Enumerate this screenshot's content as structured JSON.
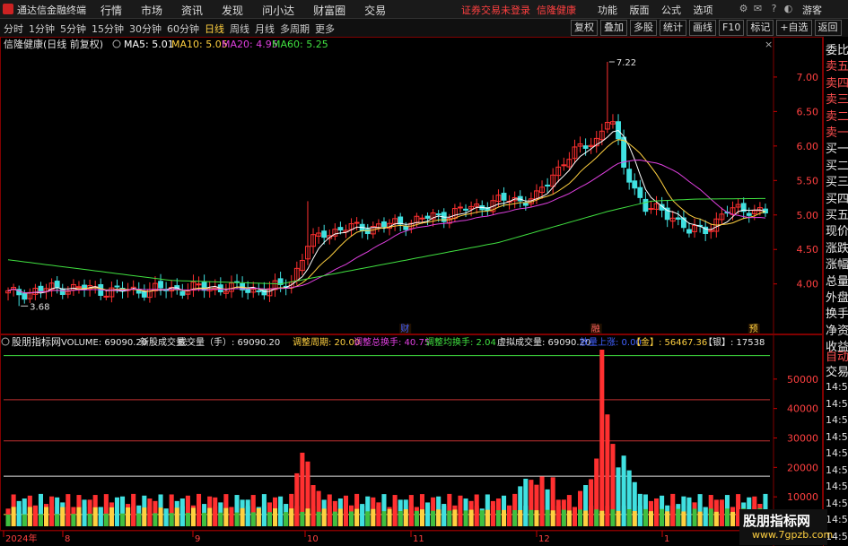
{
  "app": {
    "title": "通达信金融终端",
    "menu": [
      "行情",
      "市场",
      "资讯",
      "发现",
      "问小达",
      "财富圈",
      "交易"
    ],
    "warning": "证券交易未登录",
    "stock_name": "信隆健康",
    "right_menu": [
      "功能",
      "版面",
      "公式",
      "选项"
    ],
    "guest": "游客"
  },
  "tabs": {
    "items": [
      "分时",
      "1分钟",
      "5分钟",
      "15分钟",
      "30分钟",
      "60分钟",
      "日线",
      "周线",
      "月线",
      "多周期",
      "更多"
    ],
    "active": "日线"
  },
  "tools": [
    "复权",
    "叠加",
    "多股",
    "统计",
    "画线",
    "F10",
    "标记",
    "+自选",
    "返回"
  ],
  "price_panel": {
    "title": "信隆健康(日线 前复权)",
    "ma": [
      {
        "label": "MA5: 5.01",
        "color": "#ffffff"
      },
      {
        "label": "MA10: 5.05",
        "color": "#ffd040"
      },
      {
        "label": "MA20: 4.95",
        "color": "#e040e0"
      },
      {
        "label": "MA60: 5.25",
        "color": "#40e040"
      }
    ],
    "high_label": "7.22",
    "low_label": "3.68",
    "markers": [
      "财",
      "融",
      "预"
    ],
    "yticks": [
      "7.00",
      "6.50",
      "6.00",
      "5.50",
      "5.00",
      "4.50",
      "4.00"
    ]
  },
  "volume_panel": {
    "title": "股朋指标网",
    "indicators": [
      {
        "label": "VOLUME: 69090.20",
        "color": "#e8e8e8"
      },
      {
        "label": "新股成交量: -",
        "color": "#e8e8e8"
      },
      {
        "label": "成交量（手）: 69090.20",
        "color": "#e8e8e8"
      },
      {
        "label": "调整周期: 20.00",
        "color": "#ffd040"
      },
      {
        "label": "调整总换手: 40.75",
        "color": "#e040e0"
      },
      {
        "label": "调整均换手: 2.04",
        "color": "#40e040"
      },
      {
        "label": "虚拟成交量: 69090.20",
        "color": "#e8e8e8"
      },
      {
        "label": "放量上涨: 0.00",
        "color": "#4060ff"
      },
      {
        "label": "【金】: 56467.36",
        "color": "#ffd040"
      },
      {
        "label": "【银】: 17538",
        "color": "#e8e8e8"
      }
    ],
    "yticks": [
      "50000",
      "40000",
      "30000",
      "20000",
      "10000"
    ]
  },
  "xaxis": [
    "2024年",
    "8",
    "9",
    "10",
    "11",
    "12",
    "1"
  ],
  "right_panel": {
    "items": [
      "委比",
      "卖五",
      "卖四",
      "卖三",
      "卖二",
      "卖一",
      "买一",
      "买二",
      "买三",
      "买四",
      "买五",
      "现价",
      "涨跌",
      "涨幅",
      "总量",
      "外盘",
      "换手",
      "净资",
      "收益"
    ],
    "lower": [
      "自动",
      "交易"
    ],
    "times": [
      "14:56",
      "14:56",
      "14:56",
      "14:56",
      "14:56",
      "14:56",
      "14:56",
      "14:56",
      "14:56",
      "14:56"
    ]
  },
  "watermark": {
    "main": "股朋指标网",
    "url": "www.7gpzb.com"
  },
  "colors": {
    "up": "#ff3030",
    "down": "#40e0e0",
    "grid": "#800000"
  }
}
